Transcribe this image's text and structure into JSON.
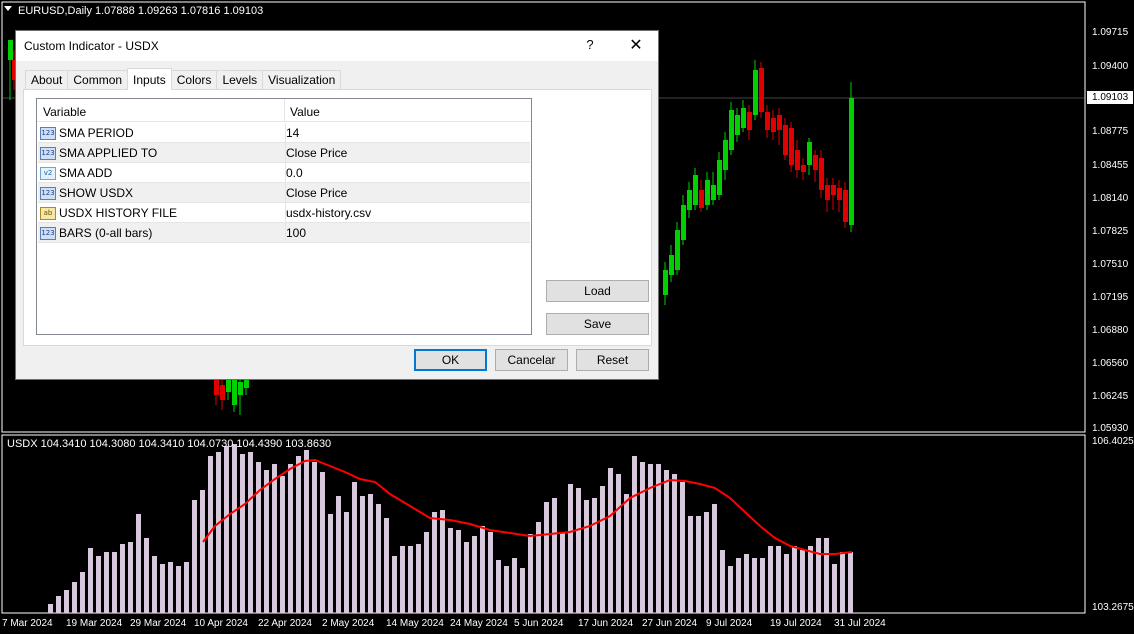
{
  "chart": {
    "symbol_label": "EURUSD,Daily  1.07888 1.09263 1.07816 1.09103",
    "indicator_label": "USDX 104.3410 104.3080 104.3410 104.0730 104.4390 103.8630",
    "price_axis": [
      "1.09715",
      "1.09400",
      "1.08775",
      "1.08455",
      "1.08140",
      "1.07825",
      "1.07510",
      "1.07195",
      "1.06880",
      "1.06560",
      "1.06245",
      "1.05930"
    ],
    "current_price": "1.09103",
    "indicator_axis": [
      "106.4025",
      "103.2675"
    ],
    "date_axis": [
      "7 Mar 2024",
      "19 Mar 2024",
      "29 Mar 2024",
      "10 Apr 2024",
      "22 Apr 2024",
      "2 May 2024",
      "14 May 2024",
      "24 May 2024",
      "5 Jun 2024",
      "17 Jun 2024",
      "27 Jun 2024",
      "9 Jul 2024",
      "19 Jul 2024",
      "31 Jul 2024"
    ],
    "colors": {
      "bull": "#00d000",
      "bear": "#e00000",
      "histogram": "#d8c8dc",
      "sma": "#ff0000",
      "grid": "#ffffff"
    }
  },
  "dialog": {
    "title": "Custom Indicator - USDX",
    "help": "?",
    "close": "✕",
    "tabs": [
      "About",
      "Common",
      "Inputs",
      "Colors",
      "Levels",
      "Visualization"
    ],
    "active_tab": "Inputs",
    "grid": {
      "col_variable": "Variable",
      "col_value": "Value",
      "rows": [
        {
          "icon": "123",
          "variable": "SMA PERIOD",
          "value": "14"
        },
        {
          "icon": "123",
          "variable": "SMA APPLIED TO",
          "value": "Close Price"
        },
        {
          "icon": "v2",
          "variable": "SMA ADD",
          "value": "0.0"
        },
        {
          "icon": "123",
          "variable": "SHOW USDX",
          "value": "Close Price"
        },
        {
          "icon": "ab",
          "variable": "USDX HISTORY FILE",
          "value": "usdx-history.csv"
        },
        {
          "icon": "123",
          "variable": "BARS (0-all bars)",
          "value": "100"
        }
      ]
    },
    "load": "Load",
    "save": "Save",
    "ok": "OK",
    "cancel": "Cancelar",
    "reset": "Reset"
  }
}
